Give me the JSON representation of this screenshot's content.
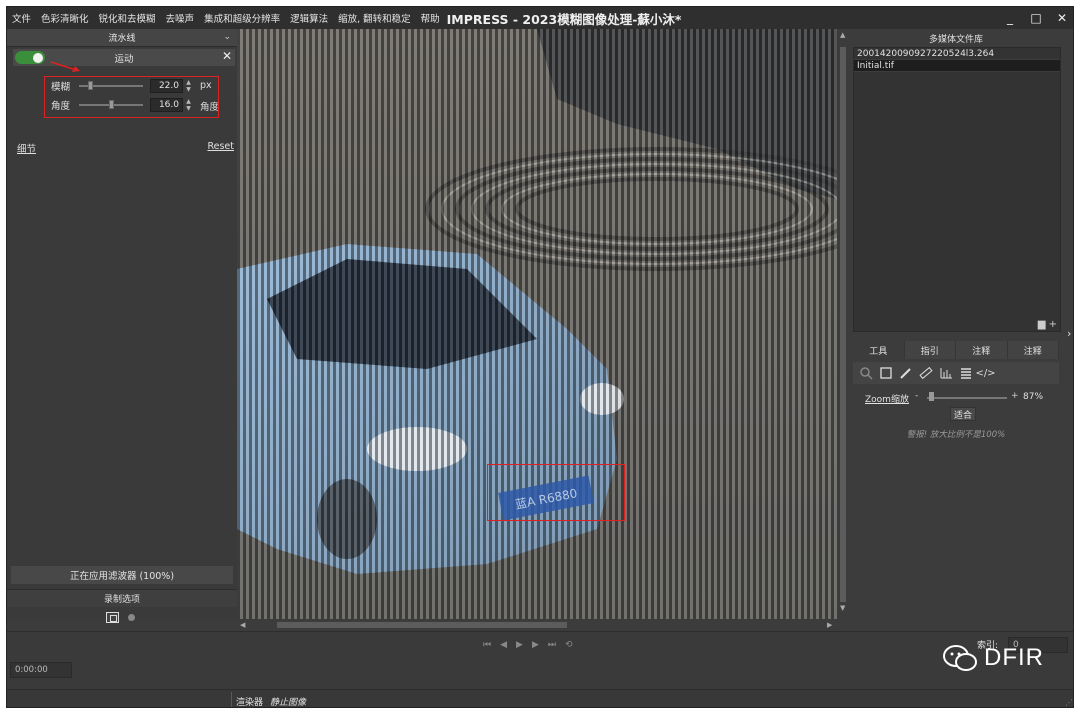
{
  "menu": {
    "items": [
      "文件",
      "色彩清晰化",
      "锐化和去模糊",
      "去噪声",
      "集成和超级分辨率",
      "逻辑算法",
      "缩放, 翻转和稳定",
      "帮助"
    ],
    "title": "IMPRESS - 2023模糊图像处理-蘇小沐*"
  },
  "window_controls": {
    "minimize": "_",
    "maximize": "□",
    "close": "✕"
  },
  "left_panel": {
    "pipeline_title": "流水线",
    "filter": {
      "name": "运动",
      "enabled": true,
      "close": "✕"
    },
    "params": [
      {
        "label": "模糊",
        "value": "22.0",
        "unit": "px",
        "level": 0.15
      },
      {
        "label": "角度",
        "value": "16.0",
        "unit": "角度",
        "level": 0.5
      }
    ],
    "detail_label": "细节",
    "reset_label": "Reset",
    "status": "正在应用滤波器 (100%)",
    "record_title": "录制选项"
  },
  "viewer": {
    "plate_text": "蓝A R6880"
  },
  "right_panel": {
    "library_title": "多媒体文件库",
    "files": [
      {
        "name": "2001420090927220524l3.264",
        "selected": false
      },
      {
        "name": "Initial.tif",
        "selected": true
      }
    ],
    "tabs": [
      "工具",
      "指引",
      "注释",
      "注释"
    ],
    "tools": [
      "zoom-icon",
      "crop-icon",
      "eyedropper-icon",
      "ruler-icon",
      "histogram-icon",
      "layers-icon",
      "code-icon"
    ],
    "zoom_label": "Zoom缩放",
    "zoom_minus": "-",
    "zoom_plus": "+",
    "zoom_value": "87%",
    "zoom_level": 0.87,
    "fit_label": "适合",
    "warning": "警报! 放大比例不是100%"
  },
  "bottom": {
    "time": "0:00:00",
    "index_label": "索引:",
    "index_value": "0",
    "renderer_label": "渲染器",
    "still_label": "静止图像"
  },
  "watermark": "DFIR"
}
